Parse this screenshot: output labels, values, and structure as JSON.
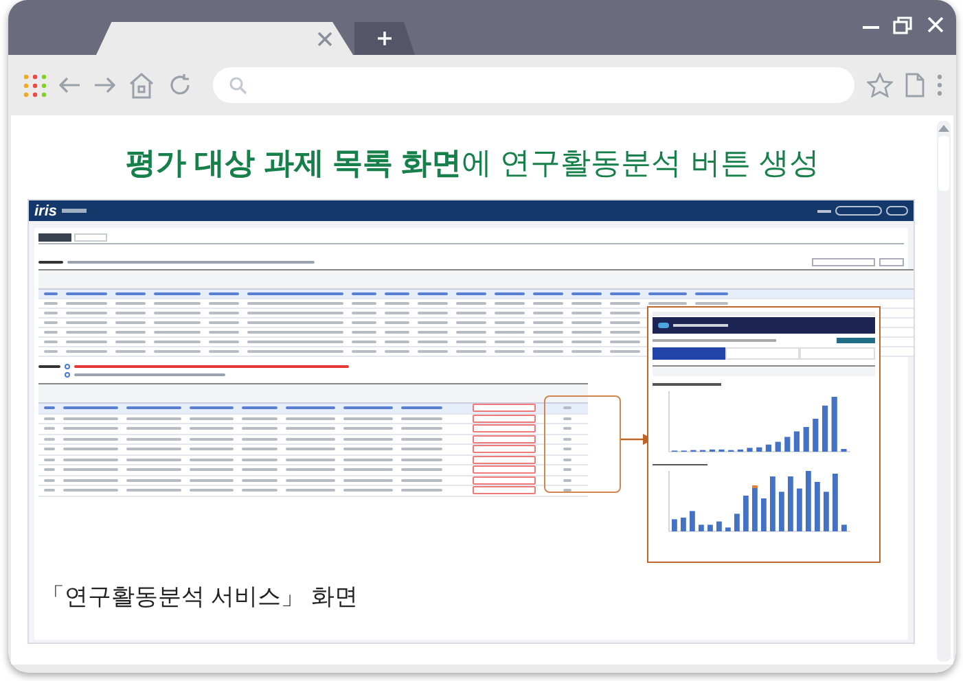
{
  "heading": "**평가 대상 과제 목록 화면**에 연구활동분석 버튼 생성",
  "embedded_screen": {
    "logo": "iris",
    "app_tabs": [
      {
        "selected": true
      },
      {
        "selected": false
      }
    ],
    "report_tabs": [
      {
        "selected": true
      },
      {
        "selected": false
      },
      {
        "selected": false
      }
    ],
    "upper_table_rows": [
      {
        "selected": true
      },
      {
        "selected": false
      },
      {
        "selected": false
      },
      {
        "selected": false
      },
      {
        "selected": false
      },
      {
        "selected": false
      },
      {
        "selected": false
      }
    ],
    "lower_table_rows": [
      {
        "selected": true
      },
      {
        "selected": false
      },
      {
        "selected": false
      },
      {
        "selected": false
      },
      {
        "selected": false
      },
      {
        "selected": false
      },
      {
        "selected": false
      },
      {
        "selected": false
      },
      {
        "selected": false
      }
    ]
  },
  "caption": "「연구활동분석 서비스」 화면"
}
